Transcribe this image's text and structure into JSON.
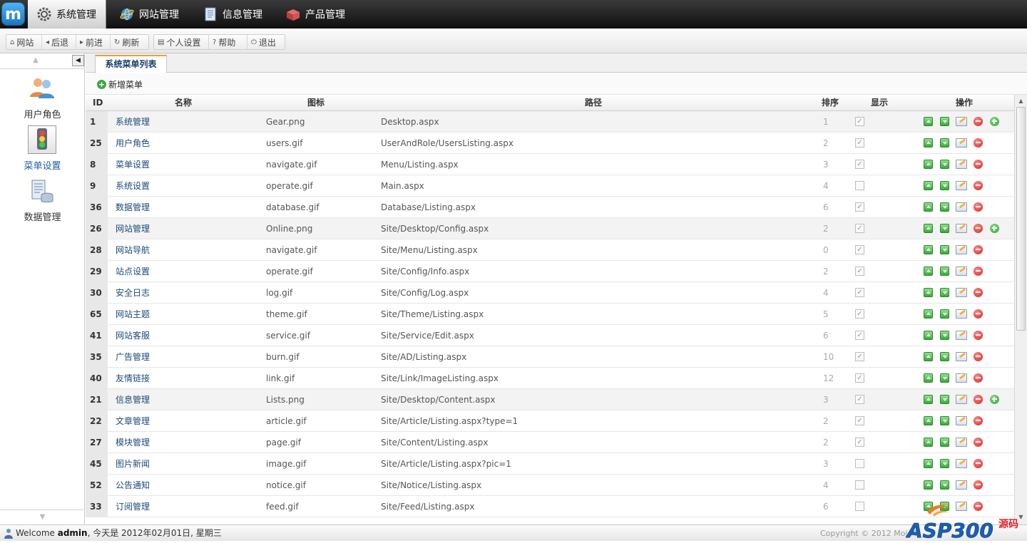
{
  "app": {
    "logo_text": "m"
  },
  "topnav": [
    {
      "label": "系统管理",
      "icon": "gear-icon",
      "active": true
    },
    {
      "label": "网站管理",
      "icon": "globe-icon",
      "active": false
    },
    {
      "label": "信息管理",
      "icon": "document-icon",
      "active": false
    },
    {
      "label": "产品管理",
      "icon": "box-icon",
      "active": false
    }
  ],
  "toolbar": {
    "site": "网站",
    "back": "后退",
    "forward": "前进",
    "refresh": "刷新",
    "personal": "个人设置",
    "help": "帮助",
    "logout": "退出"
  },
  "sidebar": {
    "items": [
      {
        "label": "用户角色",
        "icon": "users-icon",
        "active": false
      },
      {
        "label": "菜单设置",
        "icon": "traffic-light-icon",
        "active": true
      },
      {
        "label": "数据管理",
        "icon": "database-icon",
        "active": false
      }
    ]
  },
  "tab": {
    "label": "系统菜单列表"
  },
  "actions": {
    "add_label": "新增菜单"
  },
  "table": {
    "columns": {
      "id": "ID",
      "name": "名称",
      "icon": "图标",
      "path": "路径",
      "order": "排序",
      "show": "显示",
      "ops": "操作"
    },
    "rows": [
      {
        "id": "1",
        "name": "系统管理",
        "icon": "Gear.png",
        "path": "Desktop.aspx",
        "order": "1",
        "show": true,
        "parent": true,
        "add": true
      },
      {
        "id": "25",
        "name": "用户角色",
        "icon": "users.gif",
        "path": "UserAndRole/UsersListing.aspx",
        "order": "2",
        "show": true,
        "parent": false,
        "add": false
      },
      {
        "id": "8",
        "name": "菜单设置",
        "icon": "navigate.gif",
        "path": "Menu/Listing.aspx",
        "order": "3",
        "show": true,
        "parent": false,
        "add": false
      },
      {
        "id": "9",
        "name": "系统设置",
        "icon": "operate.gif",
        "path": "Main.aspx",
        "order": "4",
        "show": false,
        "parent": false,
        "add": false
      },
      {
        "id": "36",
        "name": "数据管理",
        "icon": "database.gif",
        "path": "Database/Listing.aspx",
        "order": "6",
        "show": true,
        "parent": false,
        "add": false
      },
      {
        "id": "26",
        "name": "网站管理",
        "icon": "Online.png",
        "path": "Site/Desktop/Config.aspx",
        "order": "2",
        "show": true,
        "parent": true,
        "add": true
      },
      {
        "id": "28",
        "name": "网站导航",
        "icon": "navigate.gif",
        "path": "Site/Menu/Listing.aspx",
        "order": "0",
        "show": true,
        "parent": false,
        "add": false
      },
      {
        "id": "29",
        "name": "站点设置",
        "icon": "operate.gif",
        "path": "Site/Config/Info.aspx",
        "order": "2",
        "show": true,
        "parent": false,
        "add": false
      },
      {
        "id": "30",
        "name": "安全日志",
        "icon": "log.gif",
        "path": "Site/Config/Log.aspx",
        "order": "4",
        "show": true,
        "parent": false,
        "add": false
      },
      {
        "id": "65",
        "name": "网站主题",
        "icon": "theme.gif",
        "path": "Site/Theme/Listing.aspx",
        "order": "5",
        "show": true,
        "parent": false,
        "add": false
      },
      {
        "id": "41",
        "name": "网站客服",
        "icon": "service.gif",
        "path": "Site/Service/Edit.aspx",
        "order": "6",
        "show": true,
        "parent": false,
        "add": false
      },
      {
        "id": "35",
        "name": "广告管理",
        "icon": "burn.gif",
        "path": "Site/AD/Listing.aspx",
        "order": "10",
        "show": true,
        "parent": false,
        "add": false
      },
      {
        "id": "40",
        "name": "友情链接",
        "icon": "link.gif",
        "path": "Site/Link/ImageListing.aspx",
        "order": "12",
        "show": true,
        "parent": false,
        "add": false
      },
      {
        "id": "21",
        "name": "信息管理",
        "icon": "Lists.png",
        "path": "Site/Desktop/Content.aspx",
        "order": "3",
        "show": true,
        "parent": true,
        "add": true
      },
      {
        "id": "22",
        "name": "文章管理",
        "icon": "article.gif",
        "path": "Site/Article/Listing.aspx?type=1",
        "order": "2",
        "show": true,
        "parent": false,
        "add": false
      },
      {
        "id": "27",
        "name": "模块管理",
        "icon": "page.gif",
        "path": "Site/Content/Listing.aspx",
        "order": "2",
        "show": true,
        "parent": false,
        "add": false
      },
      {
        "id": "45",
        "name": "图片新闻",
        "icon": "image.gif",
        "path": "Site/Article/Listing.aspx?pic=1",
        "order": "3",
        "show": false,
        "parent": false,
        "add": false
      },
      {
        "id": "52",
        "name": "公告通知",
        "icon": "notice.gif",
        "path": "Site/Notice/Listing.aspx",
        "order": "4",
        "show": false,
        "parent": false,
        "add": false
      },
      {
        "id": "33",
        "name": "订阅管理",
        "icon": "feed.gif",
        "path": "Site/Feed/Listing.aspx",
        "order": "6",
        "show": false,
        "parent": false,
        "add": false
      }
    ]
  },
  "status": {
    "welcome": "Welcome",
    "user": "admin",
    "date_text": ", 今天是 2012年02月01日, 星期三"
  },
  "copyright": "Copyright © 2012 MojoC",
  "watermark": {
    "brand": "ASP300",
    "suffix": "源码"
  },
  "colors": {
    "accent": "#f0a030",
    "link": "#1e4a7a",
    "topbar": "#1a1a1a"
  }
}
